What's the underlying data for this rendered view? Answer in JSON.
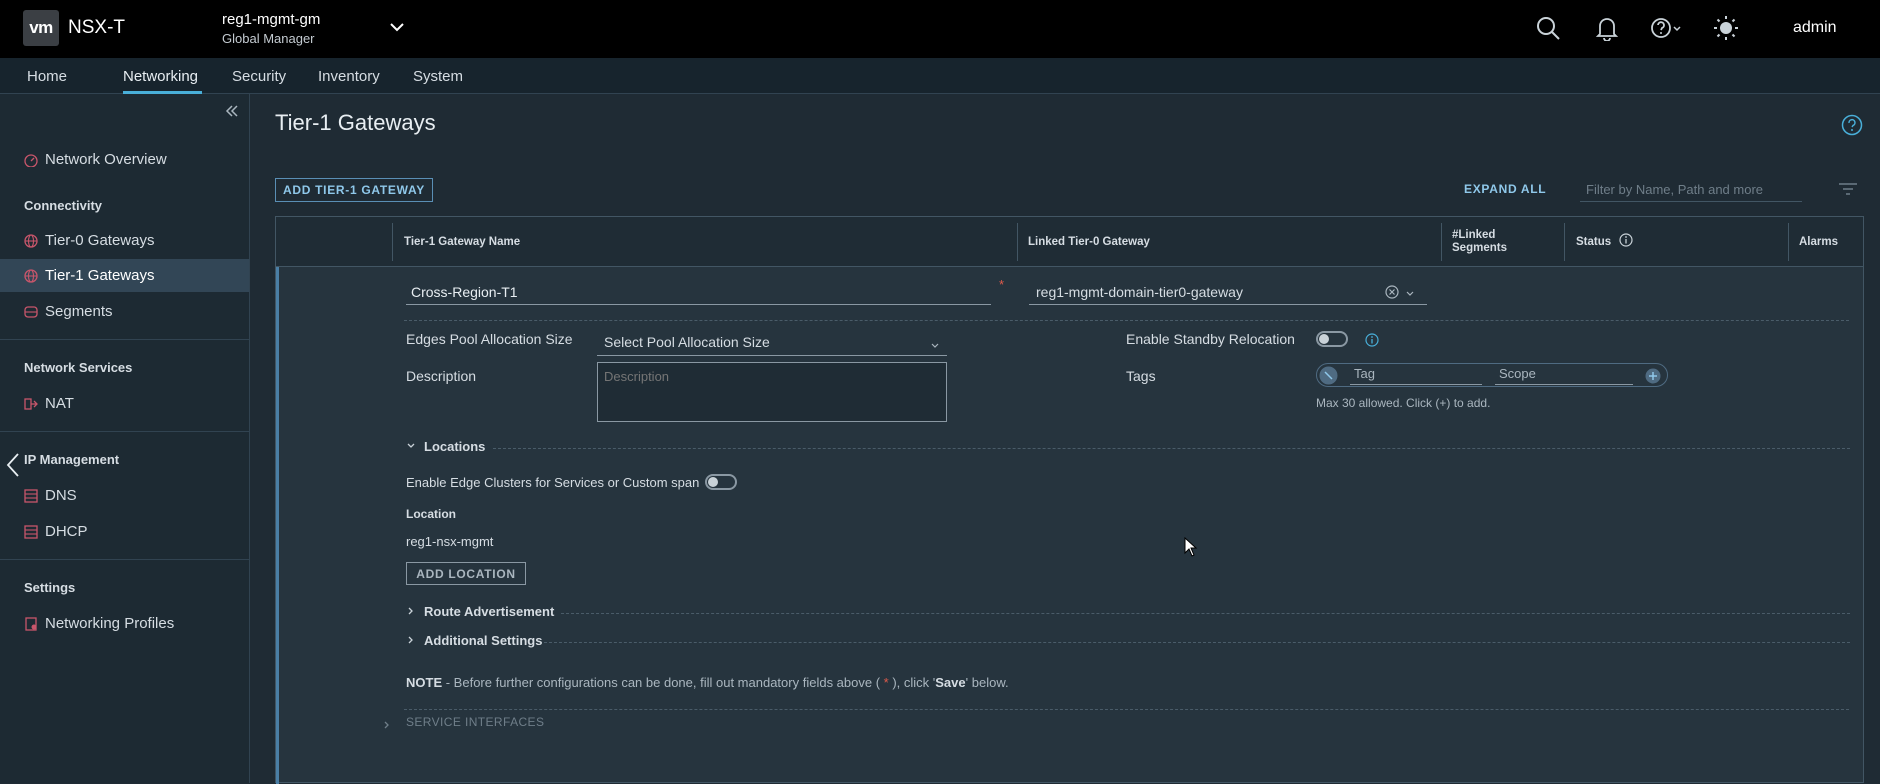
{
  "header": {
    "logo": "vm",
    "app_name": "NSX-T",
    "manager_name": "reg1-mgmt-gm",
    "manager_sub": "Global Manager",
    "user": "admin",
    "icons": [
      "search-icon",
      "bell-icon",
      "help-icon",
      "theme-sun-icon"
    ]
  },
  "nav": {
    "tabs": [
      {
        "label": "Home"
      },
      {
        "label": "Networking"
      },
      {
        "label": "Security"
      },
      {
        "label": "Inventory"
      },
      {
        "label": "System"
      }
    ],
    "active": "Networking"
  },
  "sidebar": {
    "network_overview": "Network Overview",
    "connectivity_header": "Connectivity",
    "tier0": "Tier-0 Gateways",
    "tier1": "Tier-1 Gateways",
    "segments": "Segments",
    "network_services_header": "Network Services",
    "nat": "NAT",
    "ip_management_header": "IP Management",
    "dns": "DNS",
    "dhcp": "DHCP",
    "settings_header": "Settings",
    "networking_profiles": "Networking Profiles"
  },
  "main": {
    "title": "Tier-1 Gateways",
    "add_button": "ADD TIER-1 GATEWAY",
    "expand_all": "EXPAND ALL",
    "filter_placeholder": "Filter by Name, Path and more",
    "columns": {
      "name": "Tier-1 Gateway Name",
      "linked_t0": "Linked Tier-0 Gateway",
      "linked_segments_1": "#Linked",
      "linked_segments_2": "Segments",
      "status": "Status",
      "alarms": "Alarms"
    },
    "row": {
      "name_value": "Cross-Region-T1",
      "linked_t0_value": "reg1-mgmt-domain-tier0-gateway",
      "edges_pool_label": "Edges Pool Allocation Size",
      "edges_pool_value": "Select Pool Allocation Size",
      "description_label": "Description",
      "description_placeholder": "Description",
      "standby_label": "Enable Standby Relocation",
      "tags_label": "Tags",
      "tag_placeholder": "Tag",
      "scope_placeholder": "Scope",
      "tags_hint": "Max 30 allowed. Click (+) to add.",
      "locations_section": "Locations",
      "edge_clusters_label": "Enable Edge Clusters for Services or Custom span",
      "location_header": "Location",
      "location_value": "reg1-nsx-mgmt",
      "add_location": "ADD LOCATION",
      "route_adv": "Route Advertisement",
      "additional_settings": "Additional Settings",
      "note_prefix": "NOTE",
      "note_text": " - Before further configurations can be done, fill out mandatory fields above ( ",
      "note_star": "*",
      "note_mid": " ), click '",
      "note_save": "Save",
      "note_end": "' below.",
      "service_interfaces": "SERVICE INTERFACES"
    }
  }
}
